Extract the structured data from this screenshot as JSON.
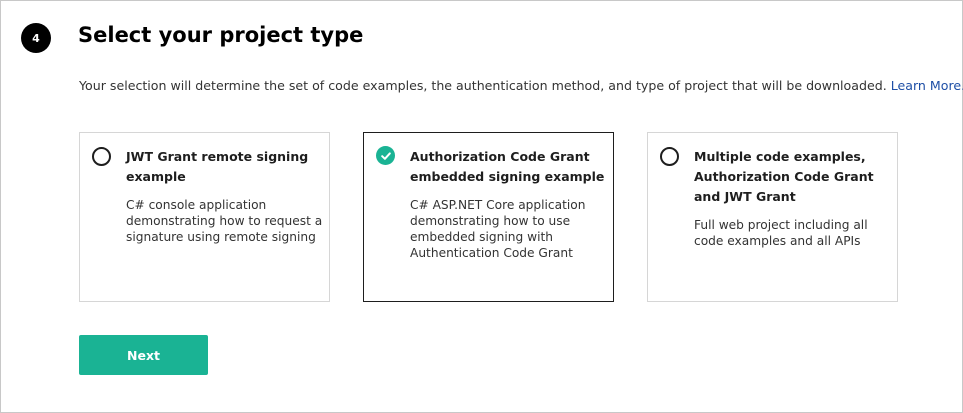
{
  "step": {
    "number": "4"
  },
  "title": "Select your project type",
  "description": {
    "text": "Your selection will determine the set of code examples, the authentication method, and type of project that will be downloaded. ",
    "link": "Learn More."
  },
  "options": [
    {
      "title": "JWT Grant remote signing example",
      "description": "C# console application demonstrating how to request a signature using remote signing",
      "selected": false
    },
    {
      "title": "Authorization Code Grant embedded signing example",
      "description": "C# ASP.NET Core application demonstrating how to use embedded signing with Authentication Code Grant",
      "selected": true
    },
    {
      "title": "Multiple code examples, Authorization Code Grant and JWT Grant",
      "description": "Full web project including all code examples and all APIs",
      "selected": false
    }
  ],
  "next_button": {
    "label": "Next"
  },
  "colors": {
    "accent": "#1ab394",
    "link": "#1e4fa6",
    "badge": "#000000",
    "selected_border": "#1e1e1e"
  },
  "icons": {
    "radio_unchecked": "radio-unchecked-icon",
    "radio_checked": "check-circle-icon"
  }
}
